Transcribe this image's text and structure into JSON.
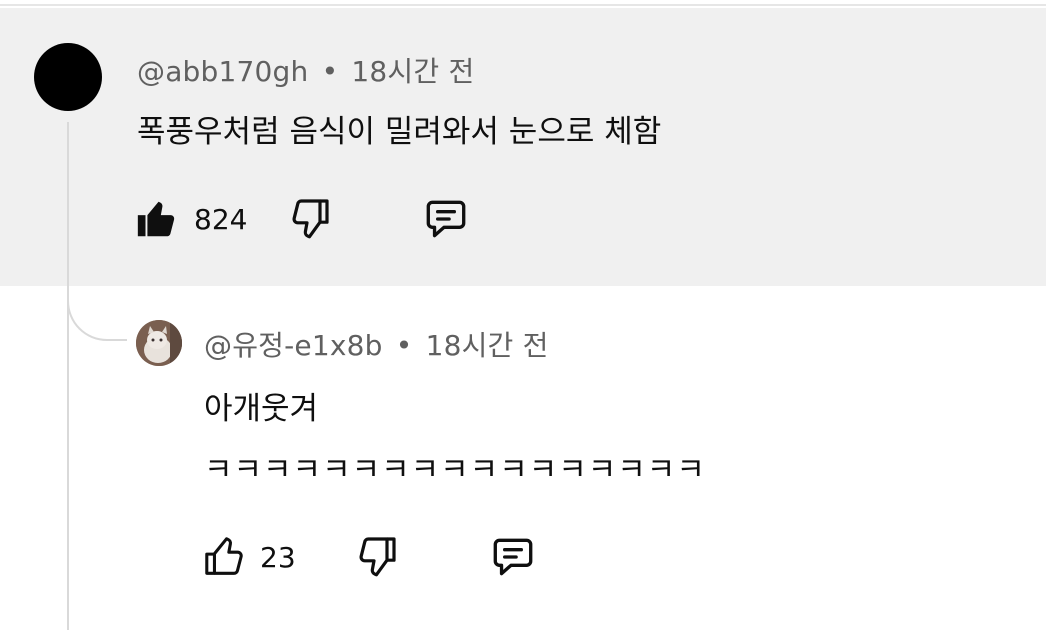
{
  "comment": {
    "author": "@abb170gh",
    "separator": "•",
    "time": "18시간 전",
    "text": "폭풍우처럼 음식이 밀려와서 눈으로 체함",
    "like_count": "824",
    "liked": true
  },
  "reply": {
    "author": "@유정-e1x8b",
    "separator": "•",
    "time": "18시간 전",
    "text_line1": "아개웃겨",
    "text_line2": "ㅋㅋㅋㅋㅋㅋㅋㅋㅋㅋㅋㅋㅋㅋㅋㅋㅋ",
    "like_count": "23",
    "liked": false
  },
  "colors": {
    "highlight_bg": "#f0f0f0",
    "meta_text": "#606060",
    "primary_text": "#0f0f0f",
    "thread_line": "#d9d9d9"
  },
  "icons": {
    "like_filled": "thumbs-up-filled-icon",
    "like_outline": "thumbs-up-outline-icon",
    "dislike": "thumbs-down-outline-icon",
    "reply": "reply-comment-icon"
  }
}
